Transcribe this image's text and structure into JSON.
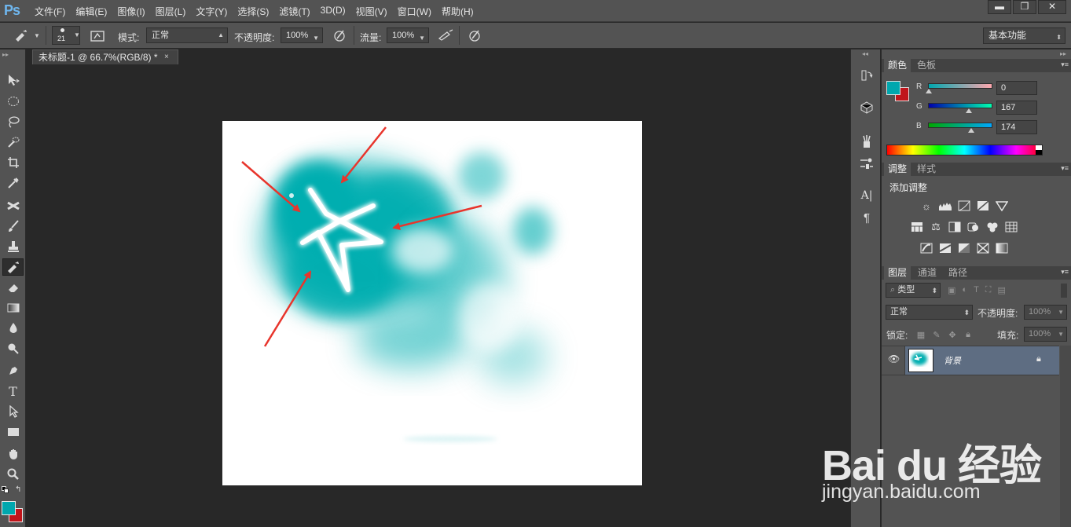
{
  "app": {
    "logo": "Ps"
  },
  "menubar": {
    "items": [
      "文件(F)",
      "编辑(E)",
      "图像(I)",
      "图层(L)",
      "文字(Y)",
      "选择(S)",
      "滤镜(T)",
      "3D(D)",
      "视图(V)",
      "窗口(W)",
      "帮助(H)"
    ],
    "win_controls": {
      "minimize": "▬",
      "restore": "❐",
      "close": "✕"
    }
  },
  "options": {
    "brush_size": "21",
    "mode_label": "模式:",
    "mode_value": "正常",
    "opacity_label": "不透明度:",
    "opacity_value": "100%",
    "flow_label": "流量:",
    "flow_value": "100%",
    "workspace": "基本功能"
  },
  "document": {
    "tab_title": "未标题-1 @ 66.7%(RGB/8) *",
    "close": "×"
  },
  "colors": {
    "foreground": "#00a7ae",
    "background": "#c0151b",
    "accent_teal": "#00aeb0",
    "arrow": "#e8352c",
    "panel_bg": "#535353",
    "layer_selected": "#5e6d82"
  },
  "color_panel": {
    "tabs": [
      "颜色",
      "色板"
    ],
    "channels": [
      {
        "name": "R",
        "value": "0"
      },
      {
        "name": "G",
        "value": "167"
      },
      {
        "name": "B",
        "value": "174"
      }
    ]
  },
  "adjust_panel": {
    "tabs": [
      "调整",
      "样式"
    ],
    "title": "添加调整"
  },
  "layers_panel": {
    "tabs": [
      "图层",
      "通道",
      "路径"
    ],
    "filter_kind": "类型",
    "blend_mode": "正常",
    "opacity_label": "不透明度:",
    "opacity_value": "100%",
    "lock_label": "锁定:",
    "fill_label": "填充:",
    "fill_value": "100%",
    "layers": [
      {
        "name": "背景",
        "visible": true,
        "locked": true
      }
    ]
  },
  "watermark": {
    "brand": "Bai du 经验",
    "url": "jingyan.baidu.com"
  }
}
